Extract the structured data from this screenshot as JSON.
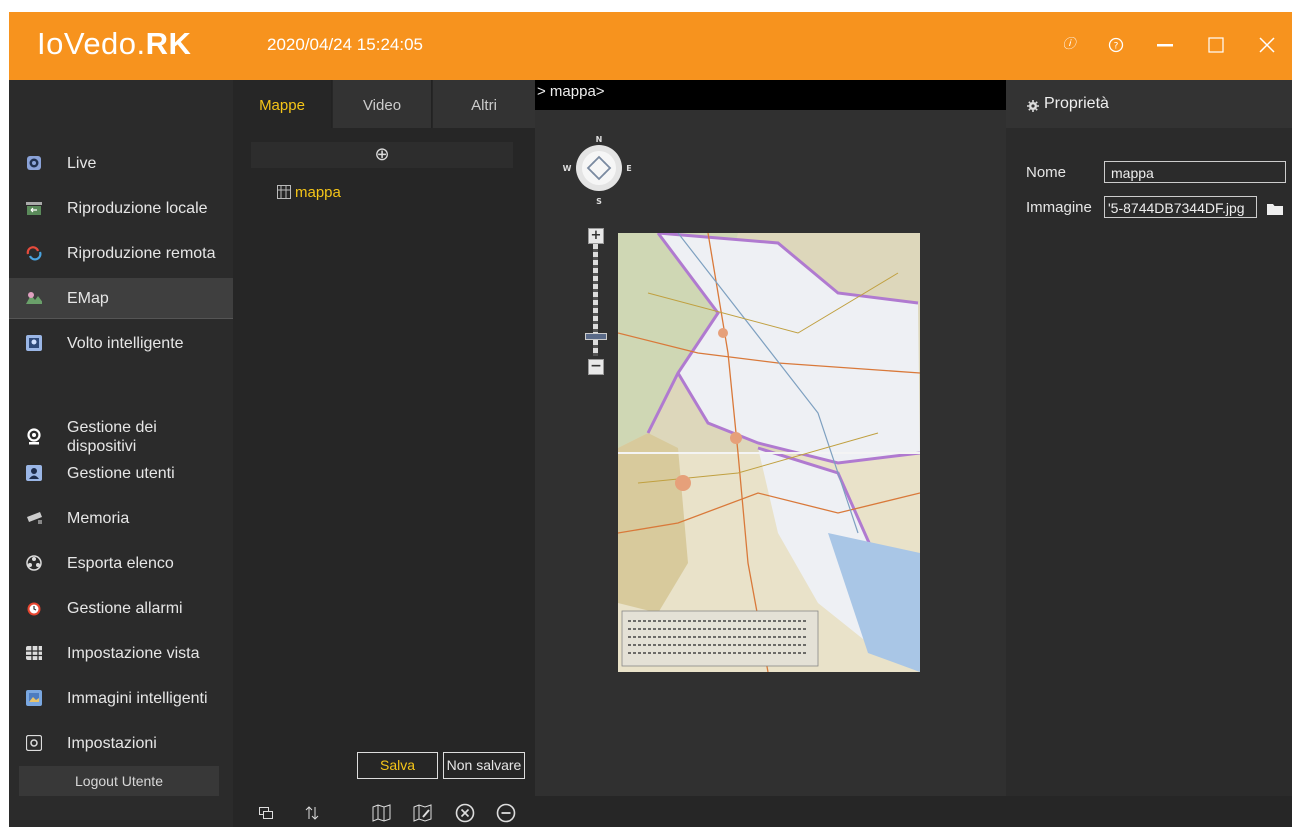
{
  "app": {
    "logo_prefix": "IoVedo.",
    "logo_suffix": "RK",
    "datetime": "2020/04/24 15:24:05",
    "brand_color": "#f7931e",
    "accent_color": "#f5c518"
  },
  "window_controls": [
    {
      "name": "info-icon",
      "glyph": "ⓘ"
    },
    {
      "name": "help-icon",
      "glyph": "?"
    },
    {
      "name": "minimize-icon",
      "glyph": "—"
    },
    {
      "name": "maximize-icon",
      "glyph": "☐"
    },
    {
      "name": "close-icon",
      "glyph": "✕"
    }
  ],
  "sidebar": {
    "items": [
      {
        "label": "Live",
        "icon": "live-icon"
      },
      {
        "label": "Riproduzione locale",
        "icon": "local-playback-icon"
      },
      {
        "label": "Riproduzione remota",
        "icon": "remote-playback-icon"
      },
      {
        "label": "EMap",
        "icon": "emap-icon",
        "active": true
      },
      {
        "label": "Volto intelligente",
        "icon": "face-icon"
      },
      {
        "label": "Gestione dei dispositivi",
        "icon": "device-icon"
      },
      {
        "label": "Gestione utenti",
        "icon": "user-icon"
      },
      {
        "label": "Memoria",
        "icon": "storage-icon"
      },
      {
        "label": "Esporta elenco",
        "icon": "export-icon"
      },
      {
        "label": "Gestione allarmi",
        "icon": "alarm-icon"
      },
      {
        "label": "Impostazione vista",
        "icon": "view-grid-icon"
      },
      {
        "label": "Immagini intelligenti",
        "icon": "smart-image-icon"
      },
      {
        "label": "Impostazioni",
        "icon": "settings-icon"
      }
    ],
    "logout_label": "Logout Utente"
  },
  "tree": {
    "tabs": [
      "Mappe",
      "Video",
      "Altri"
    ],
    "active_tab": "Mappe",
    "add_glyph": "⊕",
    "nodes": [
      {
        "label": "mappa",
        "icon": "map-node-icon"
      }
    ],
    "save_label": "Salva",
    "discard_label": "Non salvare"
  },
  "toolbar": {
    "icons": [
      "copy-icon",
      "sort-icon",
      "map-add-icon",
      "map-edit-icon",
      "delete-circle-icon",
      "remove-circle-icon"
    ]
  },
  "map": {
    "path": "> mappa>",
    "compass": {
      "n": "N",
      "s": "S",
      "e": "E",
      "w": "W"
    },
    "zoom_in": "+",
    "zoom_out": "−",
    "zoom_level": 0.82
  },
  "properties": {
    "title": "Proprietà",
    "name_label": "Nome",
    "name_value": "mappa",
    "image_label": "Immagine",
    "image_value": "'5-8744DB7344DF.jpg"
  }
}
